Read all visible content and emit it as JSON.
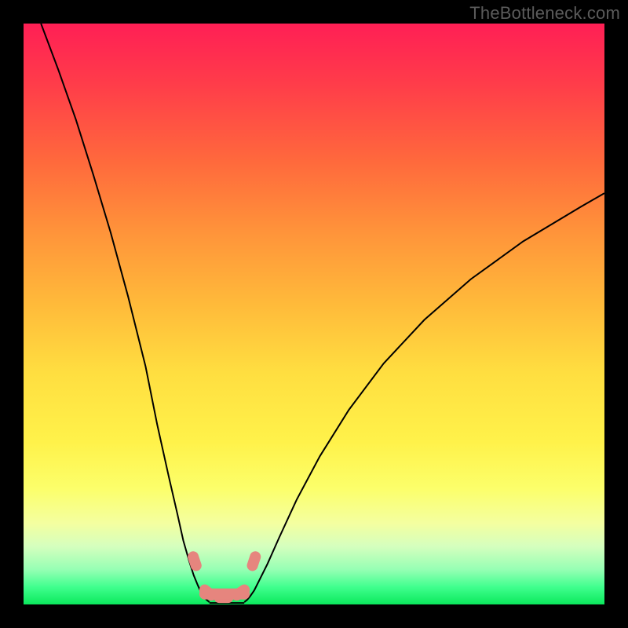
{
  "watermark": "TheBottleneck.com",
  "chart_data": {
    "type": "line",
    "title": "",
    "xlabel": "",
    "ylabel": "",
    "xlim": [
      0,
      100
    ],
    "ylim": [
      0,
      100
    ],
    "curve_left": {
      "x": [
        3,
        6,
        9,
        12,
        15,
        18,
        21,
        23,
        25,
        26.5,
        27.5,
        28.5,
        29.3,
        30,
        30.5,
        31,
        31.5,
        32
      ],
      "y": [
        100,
        92,
        83.5,
        74,
        64,
        53,
        41,
        31,
        22,
        15.5,
        11,
        7.5,
        5,
        3.3,
        2.2,
        1.4,
        0.8,
        0.4
      ]
    },
    "curve_right": {
      "x": [
        38,
        38.5,
        39,
        39.7,
        40.5,
        42,
        44,
        47,
        51,
        56,
        62,
        69,
        77,
        86,
        96,
        100
      ],
      "y": [
        0.4,
        0.8,
        1.4,
        2.4,
        4,
        7,
        11.5,
        18,
        25.5,
        33.5,
        41.5,
        49,
        56,
        62.5,
        68.5,
        70.8
      ]
    },
    "floor_segment": {
      "x": [
        32,
        38
      ],
      "y": [
        0.25,
        0.25
      ]
    },
    "valley_marks": {
      "x": [
        29.2,
        29.7,
        31.2,
        32.3,
        33.7,
        35.2,
        36.7,
        38.0,
        39.4,
        39.9
      ],
      "y": [
        8.2,
        6.7,
        2.5,
        1.6,
        1.2,
        1.2,
        1.6,
        2.5,
        6.7,
        8.2
      ]
    },
    "colors": {
      "curve": "#000000",
      "marks": "#e6857e",
      "gradient_top": "#ff1f55",
      "gradient_bottom": "#0be85c"
    }
  }
}
